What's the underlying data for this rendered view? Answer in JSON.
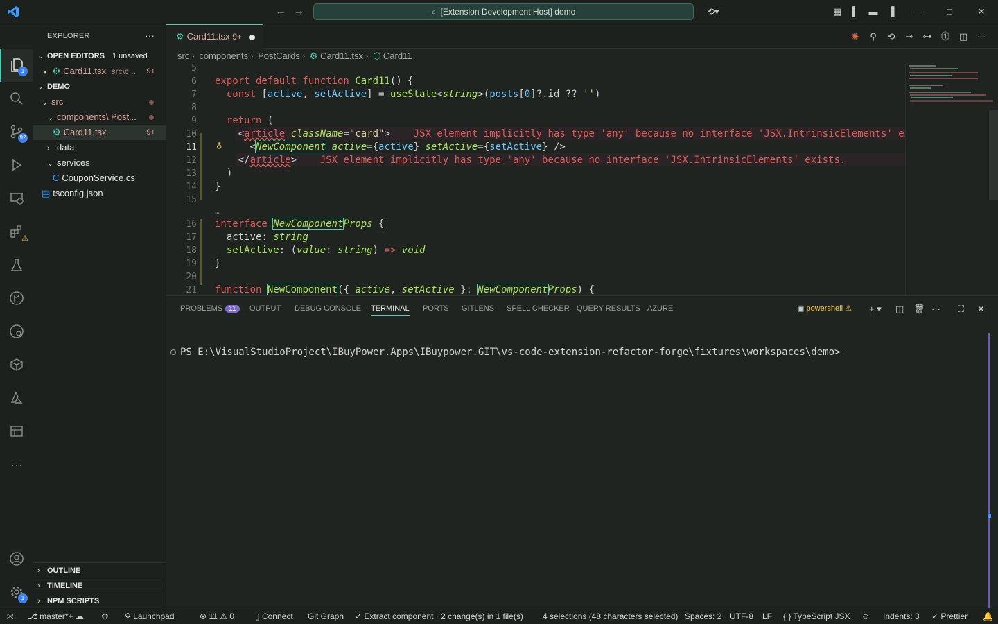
{
  "titlebar": {
    "command_center": "[Extension Development Host] demo"
  },
  "activitybar": {
    "explorer_badge": "1",
    "scm_badge": "92",
    "settings_badge": "1"
  },
  "sidebar": {
    "title": "EXPLORER",
    "open_editors": {
      "label": "OPEN EDITORS",
      "note": "1 unsaved",
      "file": "Card11.tsx",
      "path": "src\\c...",
      "count": "9+"
    },
    "demo": {
      "label": "DEMO",
      "items": [
        {
          "name": "src"
        },
        {
          "name": "components\\ Post..."
        },
        {
          "name": "Card11.tsx",
          "count": "9+"
        },
        {
          "name": "data"
        },
        {
          "name": "services"
        },
        {
          "name": "CouponService.cs"
        },
        {
          "name": "tsconfig.json"
        }
      ]
    },
    "outline": "OUTLINE",
    "timeline": "TIMELINE",
    "npm": "NPM SCRIPTS"
  },
  "tab": {
    "name": "Card11.tsx",
    "count": "9+"
  },
  "breadcrumb": [
    "src",
    "components",
    "PostCards",
    "Card11.tsx",
    "Card11"
  ],
  "editor": {
    "line_numbers": [
      "5",
      "6",
      "7",
      "8",
      "9",
      "10",
      "11",
      "12",
      "13",
      "14",
      "15",
      "16",
      "17",
      "18",
      "19",
      "20",
      "21"
    ],
    "error_10": "JSX element implicitly has type 'any' because no interface 'JSX.IntrinsicElements' ex",
    "error_12": "JSX element implicitly has type 'any' because no interface 'JSX.IntrinsicElements' exists.",
    "folded": "…"
  },
  "panel": {
    "tabs": [
      "PROBLEMS",
      "OUTPUT",
      "DEBUG CONSOLE",
      "TERMINAL",
      "PORTS",
      "GITLENS",
      "SPELL CHECKER",
      "QUERY RESULTS",
      "AZURE"
    ],
    "problems_count": "11",
    "shell": "powershell",
    "prompt": "PS E:\\VisualStudioProject\\IBuyPower.Apps\\IBuypower.GIT\\vs-code-extension-refactor-forge\\fixtures\\workspaces\\demo>"
  },
  "statusbar": {
    "branch": "master*+",
    "launchpad": "Launchpad",
    "errors": "11",
    "warnings": "0",
    "connect": "Connect",
    "gitgraph": "Git Graph",
    "extract": "Extract component · 2 change(s) in 1 file(s)",
    "selections": "4 selections (48 characters selected)",
    "spaces": "Spaces: 2",
    "encoding": "UTF-8",
    "eol": "LF",
    "language": "TypeScript JSX",
    "indents": "Indents: 3",
    "prettier": "Prettier"
  }
}
